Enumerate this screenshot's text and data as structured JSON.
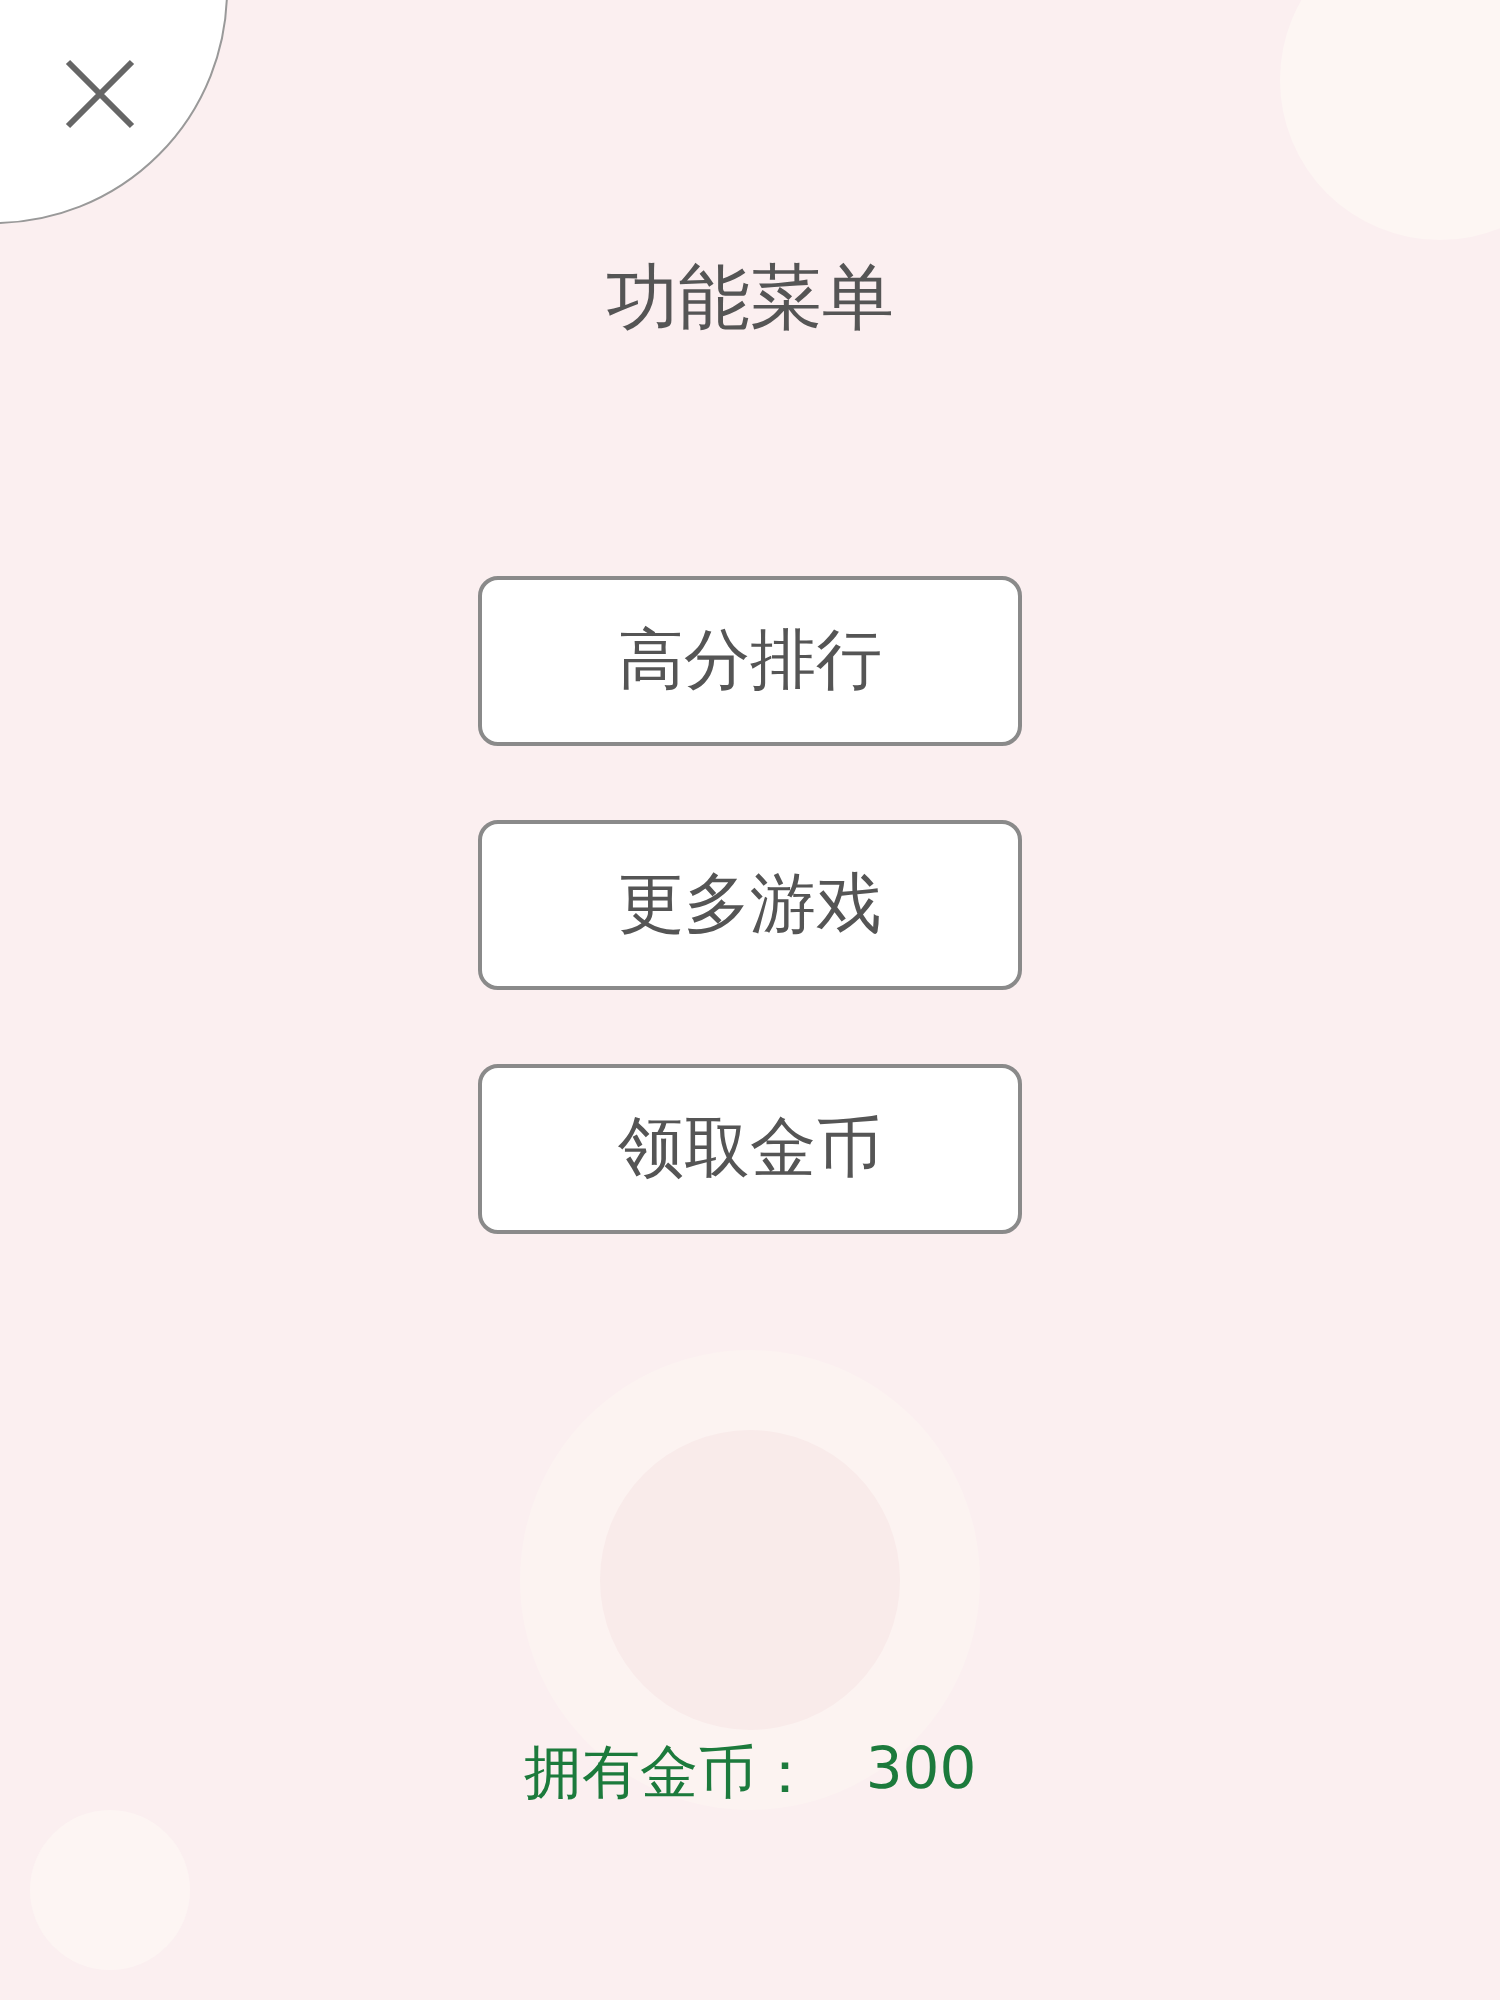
{
  "title": "功能菜单",
  "menu": [
    {
      "label": "高分排行"
    },
    {
      "label": "更多游戏"
    },
    {
      "label": "领取金币"
    }
  ],
  "coins": {
    "label": "拥有金币：",
    "value": "300"
  }
}
